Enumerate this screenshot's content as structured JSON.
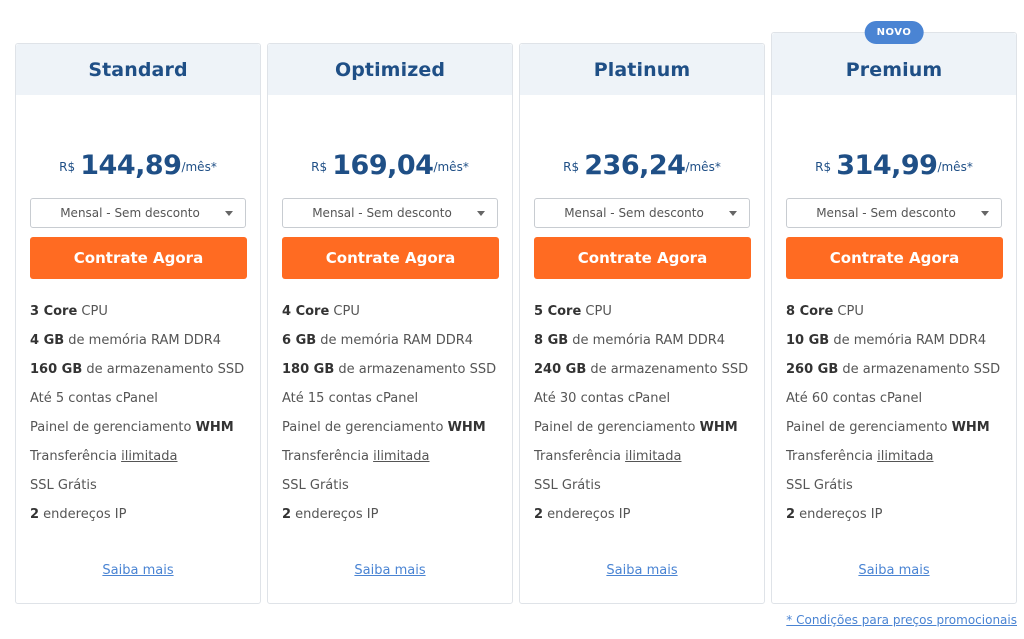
{
  "plans": [
    {
      "name": "Standard",
      "badge": "",
      "currency": "R$",
      "price": "144,89",
      "suffix": "/mês*",
      "billing": "Mensal - Sem desconto",
      "cta": "Contrate Agora",
      "features": {
        "cpu_bold": "3 Core",
        "cpu_rest": " CPU",
        "ram_bold": "4 GB",
        "ram_rest": " de memória RAM DDR4",
        "disk_bold": "160 GB",
        "disk_rest": " de armazenamento SSD",
        "cpanel": "Até 5 contas cPanel",
        "whm_pre": "Painel de gerenciamento ",
        "whm_bold": "WHM",
        "transfer_pre": "Transferência ",
        "transfer_link": "ilimitada",
        "ssl": "SSL Grátis",
        "ip_bold": "2",
        "ip_rest": " endereços IP"
      },
      "more": "Saiba mais"
    },
    {
      "name": "Optimized",
      "badge": "",
      "currency": "R$",
      "price": "169,04",
      "suffix": "/mês*",
      "billing": "Mensal - Sem desconto",
      "cta": "Contrate Agora",
      "features": {
        "cpu_bold": "4 Core",
        "cpu_rest": " CPU",
        "ram_bold": "6 GB",
        "ram_rest": " de memória RAM DDR4",
        "disk_bold": "180 GB",
        "disk_rest": " de armazenamento SSD",
        "cpanel": "Até 15 contas cPanel",
        "whm_pre": "Painel de gerenciamento ",
        "whm_bold": "WHM",
        "transfer_pre": "Transferência ",
        "transfer_link": "ilimitada",
        "ssl": "SSL Grátis",
        "ip_bold": "2",
        "ip_rest": " endereços IP"
      },
      "more": "Saiba mais"
    },
    {
      "name": "Platinum",
      "badge": "",
      "currency": "R$",
      "price": "236,24",
      "suffix": "/mês*",
      "billing": "Mensal - Sem desconto",
      "cta": "Contrate Agora",
      "features": {
        "cpu_bold": "5 Core",
        "cpu_rest": " CPU",
        "ram_bold": "8 GB",
        "ram_rest": " de memória RAM DDR4",
        "disk_bold": "240 GB",
        "disk_rest": " de armazenamento SSD",
        "cpanel": "Até 30 contas cPanel",
        "whm_pre": "Painel de gerenciamento ",
        "whm_bold": "WHM",
        "transfer_pre": "Transferência ",
        "transfer_link": "ilimitada",
        "ssl": "SSL Grátis",
        "ip_bold": "2",
        "ip_rest": " endereços IP"
      },
      "more": "Saiba mais"
    },
    {
      "name": "Premium",
      "badge": "NOVO",
      "currency": "R$",
      "price": "314,99",
      "suffix": "/mês*",
      "billing": "Mensal - Sem desconto",
      "cta": "Contrate Agora",
      "features": {
        "cpu_bold": "8 Core",
        "cpu_rest": " CPU",
        "ram_bold": "10 GB",
        "ram_rest": " de memória RAM DDR4",
        "disk_bold": "260 GB",
        "disk_rest": " de armazenamento SSD",
        "cpanel": "Até 60 contas cPanel",
        "whm_pre": "Painel de gerenciamento ",
        "whm_bold": "WHM",
        "transfer_pre": "Transferência ",
        "transfer_link": "ilimitada",
        "ssl": "SSL Grátis",
        "ip_bold": "2",
        "ip_rest": " endereços IP"
      },
      "more": "Saiba mais"
    }
  ],
  "footnote": "* Condições para preços promocionais",
  "colors": {
    "title": "#1f4f86",
    "cta": "#ff6b22",
    "link": "#4a84d3",
    "header_bg": "#eef3f8",
    "badge": "#4a84d3"
  }
}
